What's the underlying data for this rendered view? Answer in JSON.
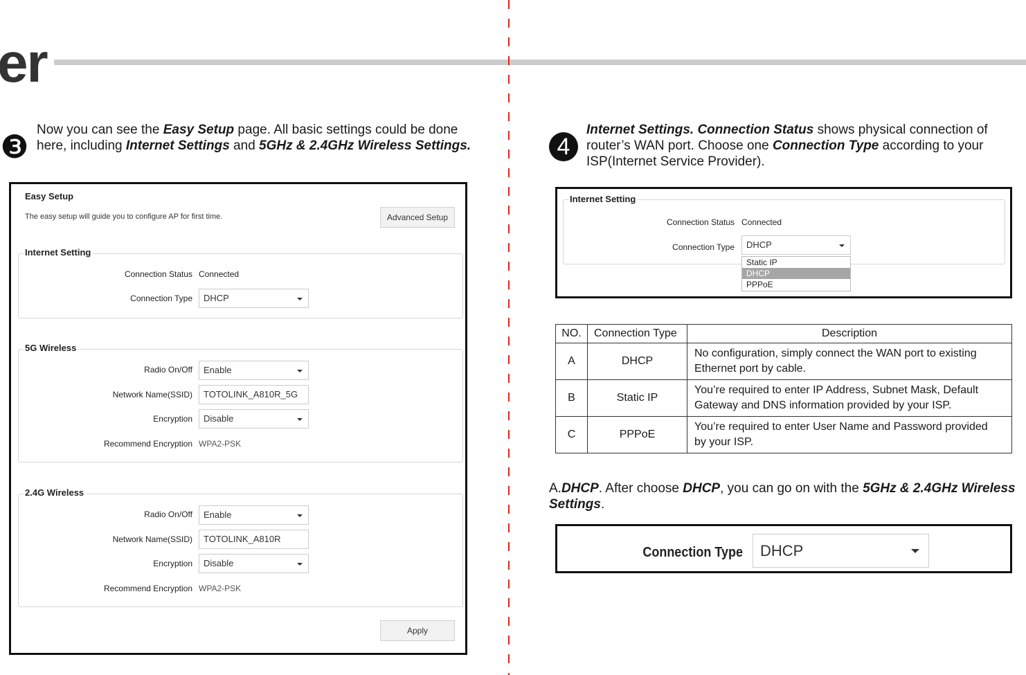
{
  "header": {
    "title_fragment": "er"
  },
  "step3": {
    "number": "❸",
    "text": {
      "p1": "Now you can see the ",
      "b1": "Easy Setup",
      "p2": " page. All basic settings could be done here, including ",
      "b2": "Internet Settings",
      "p3": " and ",
      "b3": "5GHz & 2.4GHz Wireless Settings.",
      "p4": ""
    },
    "panel": {
      "title": "Easy Setup",
      "subtitle": "The easy setup will guide you to configure AP for first time.",
      "advanced_button": "Advanced Setup",
      "internet": {
        "legend": "Internet Setting",
        "status_label": "Connection Status",
        "status_value": "Connected",
        "type_label": "Connection Type",
        "type_value": "DHCP"
      },
      "wireless_5g": {
        "legend": "5G Wireless",
        "radio_label": "Radio On/Off",
        "radio_value": "Enable",
        "ssid_label": "Network Name(SSID)",
        "ssid_value": "TOTOLINK_A810R_5G",
        "enc_label": "Encryption",
        "enc_value": "Disable",
        "rec_label": "Recommend Encryption",
        "rec_value": "WPA2-PSK"
      },
      "wireless_24g": {
        "legend": "2.4G Wireless",
        "radio_label": "Radio On/Off",
        "radio_value": "Enable",
        "ssid_label": "Network Name(SSID)",
        "ssid_value": "TOTOLINK_A810R",
        "enc_label": "Encryption",
        "enc_value": "Disable",
        "rec_label": "Recommend Encryption",
        "rec_value": "WPA2-PSK"
      },
      "apply_button": "Apply"
    }
  },
  "step4": {
    "number": "4",
    "text": {
      "b1": "Internet Settings. Connection Status",
      "p1": " shows physical connection of router’s WAN port. Choose one ",
      "b2": "Connection Type",
      "p2": " according to your ISP(Internet Service Provider)."
    },
    "panel": {
      "legend": "Internet Setting",
      "status_label": "Connection Status",
      "status_value": "Connected",
      "type_label": "Connection Type",
      "type_value": "DHCP",
      "options": [
        "Static IP",
        "DHCP",
        "PPPoE"
      ]
    },
    "table": {
      "headers": [
        "NO.",
        "Connection Type",
        "Description"
      ],
      "rows": [
        {
          "no": "A",
          "type": "DHCP",
          "desc1": "No configuration, simply connect the WAN port to existing",
          "desc2": "Ethernet port by cable."
        },
        {
          "no": "B",
          "type": "Static IP",
          "desc1": "You’re required to enter IP Address, Subnet Mask, Default",
          "desc2": "Gateway and DNS information provided by your ISP."
        },
        {
          "no": "C",
          "type": "PPPoE",
          "desc1": "You’re required to enter User Name and Password provided",
          "desc2": "by your ISP."
        }
      ]
    },
    "note": {
      "p1": "A.",
      "b1": "DHCP",
      "p2": ". After choose ",
      "b2": "DHCP",
      "p3": ", you can go on with the ",
      "b3": "5GHz & 2.4GHz Wireless Settings",
      "p4": "."
    },
    "dhcp_panel": {
      "label": "Connection Type",
      "value": "DHCP"
    }
  },
  "colors": {
    "divider": "#e2231a",
    "rule": "#cccccc",
    "selected_option": "#a6a6a6"
  }
}
